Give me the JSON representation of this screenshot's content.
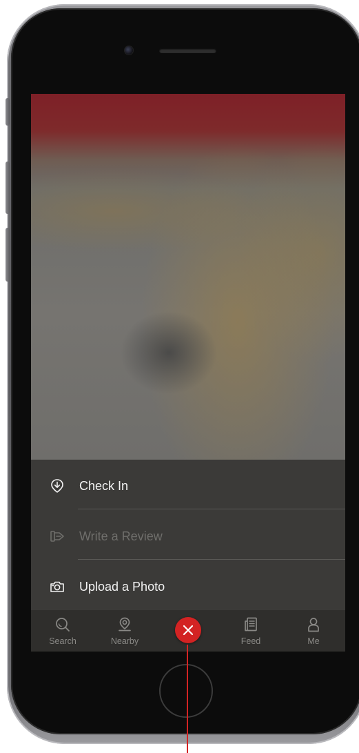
{
  "screen": {
    "menu": {
      "items": [
        {
          "label": "Check In",
          "icon": "check-in-icon",
          "enabled": true
        },
        {
          "label": "Write a Review",
          "icon": "write-review-icon",
          "enabled": false
        },
        {
          "label": "Upload a Photo",
          "icon": "camera-icon",
          "enabled": true
        }
      ]
    },
    "tab_bar": {
      "tabs": [
        {
          "label": "Search",
          "icon": "search-icon"
        },
        {
          "label": "Nearby",
          "icon": "location-pin-icon"
        },
        {
          "label": "Feed",
          "icon": "feed-icon"
        },
        {
          "label": "Me",
          "icon": "profile-icon"
        }
      ],
      "center_button": {
        "icon": "close-icon"
      }
    }
  },
  "colors": {
    "accent": "#d32323",
    "menu_background": "#3b3a38",
    "tab_bar_background": "#2f2e2c",
    "header_red": "#7e2027"
  }
}
